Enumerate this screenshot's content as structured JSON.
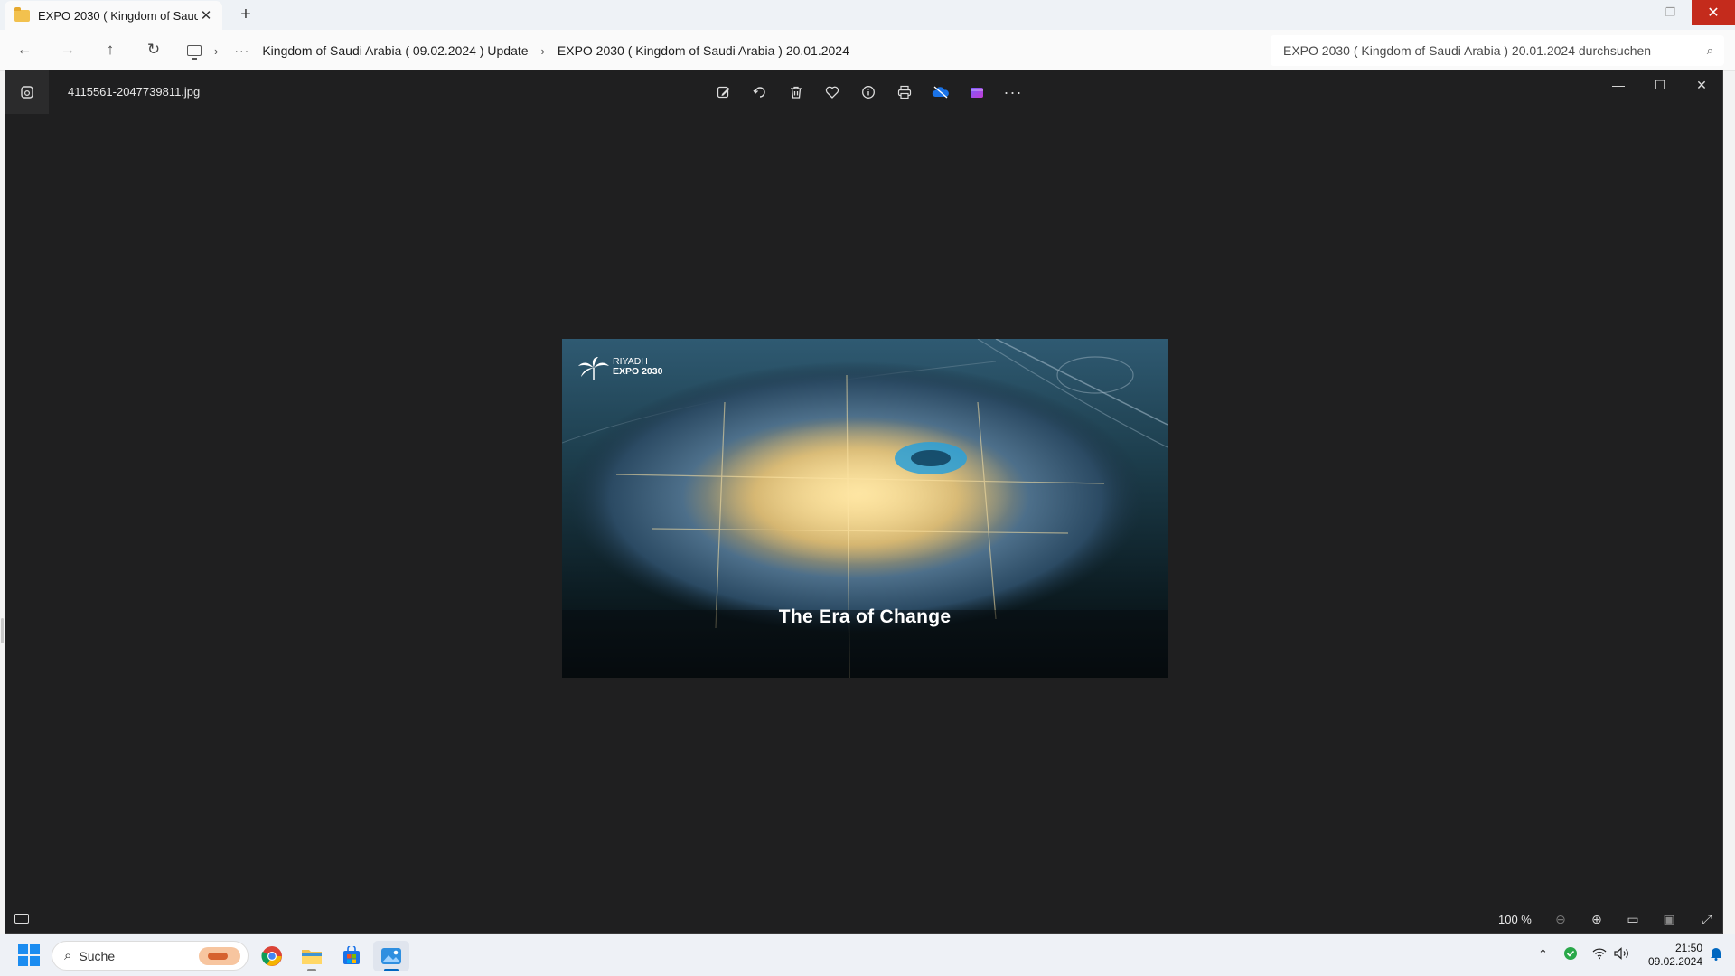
{
  "explorer": {
    "tab_title": "EXPO 2030 ( Kingdom of Saud",
    "breadcrumb": [
      "Kingdom of Saudi Arabia ( 09.02.2024 ) Update",
      "EXPO 2030 ( Kingdom of Saudi Arabia ) 20.01.2024"
    ],
    "search_placeholder": "EXPO 2030 ( Kingdom of Saudi Arabia ) 20.01.2024 durchsuchen"
  },
  "viewer": {
    "filename": "4115561-2047739811.jpg",
    "toolbar_icons": [
      "edit-icon",
      "rotate-icon",
      "delete-icon",
      "favorite-icon",
      "info-icon",
      "print-icon",
      "onedrive-icon",
      "clipchamp-icon",
      "more-icon"
    ],
    "zoom": "100 %",
    "photo": {
      "caption": "The Era of Change",
      "logo_city": "RIYADH",
      "logo_event": "EXPO 2030"
    }
  },
  "taskbar": {
    "search_label": "Suche",
    "apps": [
      "chrome-icon",
      "file-explorer-icon",
      "store-icon",
      "photos-icon"
    ],
    "time": "21:50",
    "date": "09.02.2024"
  },
  "colors": {
    "viewer_bg": "#1f1f20",
    "close_red": "#c42b1c",
    "accent": "#0067c0"
  }
}
